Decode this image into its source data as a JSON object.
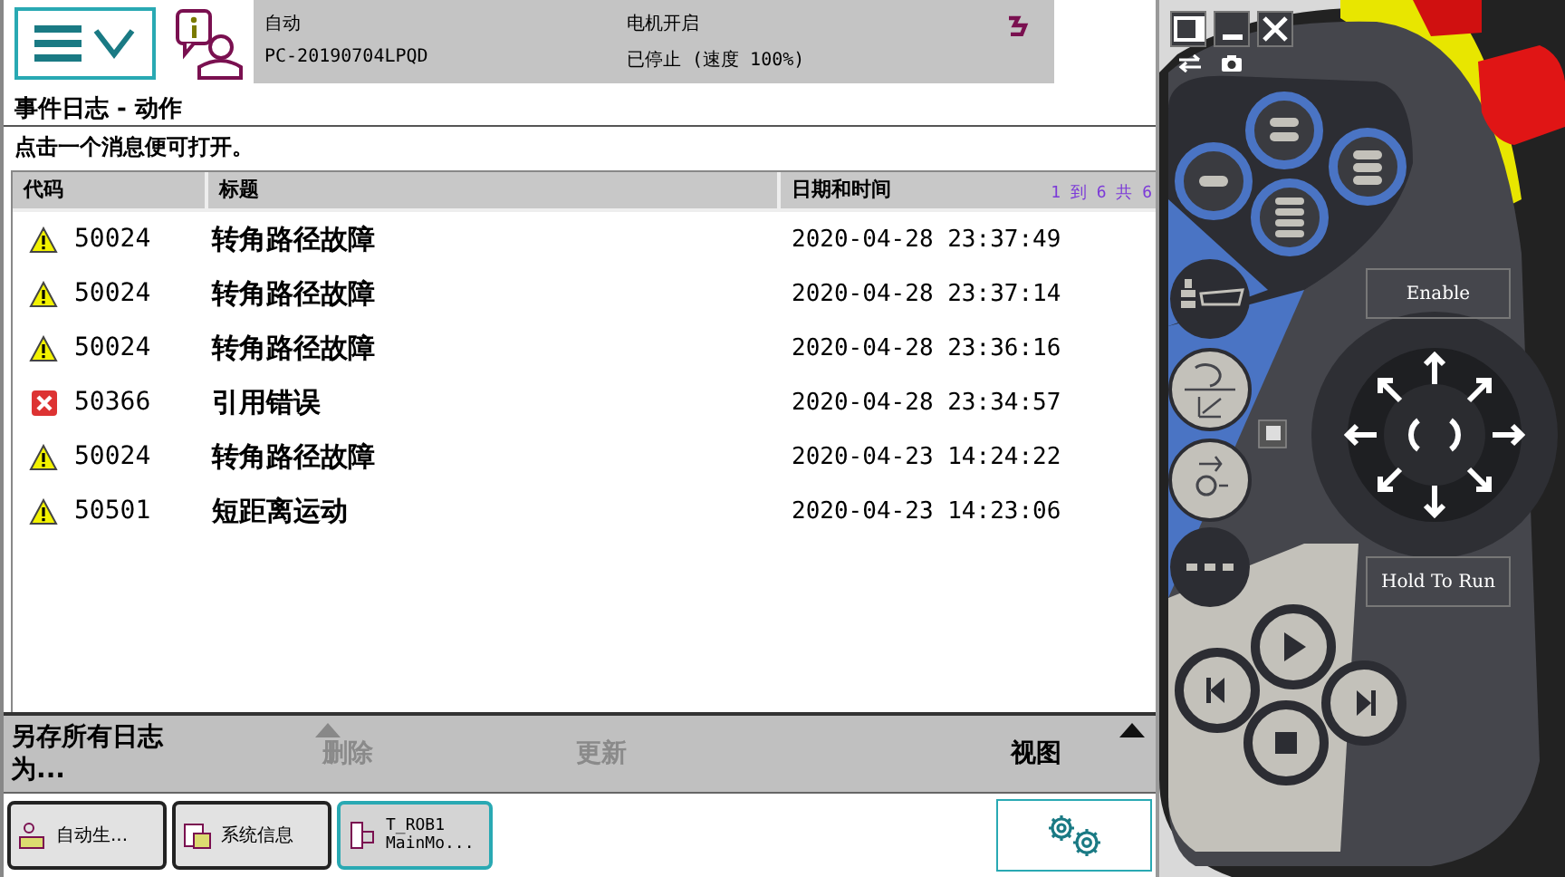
{
  "status": {
    "mode": "自动",
    "controller": "PC-20190704LPQD",
    "motors": "电机开启",
    "state": "已停止 (速度 100%)"
  },
  "title": "事件日志 - 动作",
  "hint": "点击一个消息便可打开。",
  "table": {
    "columns": [
      "代码",
      "标题",
      "日期和时间"
    ],
    "range": "1 到 6 共 6",
    "rows": [
      {
        "kind": "warning",
        "code": "50024",
        "title": "转角路径故障",
        "time": "2020-04-28 23:37:49"
      },
      {
        "kind": "warning",
        "code": "50024",
        "title": "转角路径故障",
        "time": "2020-04-28 23:37:14"
      },
      {
        "kind": "warning",
        "code": "50024",
        "title": "转角路径故障",
        "time": "2020-04-28 23:36:16"
      },
      {
        "kind": "error",
        "code": "50366",
        "title": "引用错误",
        "time": "2020-04-28 23:34:57"
      },
      {
        "kind": "warning",
        "code": "50024",
        "title": "转角路径故障",
        "time": "2020-04-23 14:24:22"
      },
      {
        "kind": "warning",
        "code": "50501",
        "title": "短距离运动",
        "time": "2020-04-23 14:23:06"
      }
    ]
  },
  "commands": [
    {
      "label": "另存所有日志为...",
      "disabled": false,
      "menu": false
    },
    {
      "label": "删除",
      "disabled": true,
      "menu": true
    },
    {
      "label": "更新",
      "disabled": true,
      "menu": false
    },
    {
      "label": "视图",
      "disabled": false,
      "menu": true
    }
  ],
  "taskbar": [
    {
      "lines": [
        "自动生..."
      ],
      "selected": false
    },
    {
      "lines": [
        "系统信息"
      ],
      "selected": false
    },
    {
      "lines": [
        "T_ROB1",
        "MainMo..."
      ],
      "selected": true
    }
  ],
  "pendant": {
    "enable": "Enable",
    "hold": "Hold To Run"
  }
}
